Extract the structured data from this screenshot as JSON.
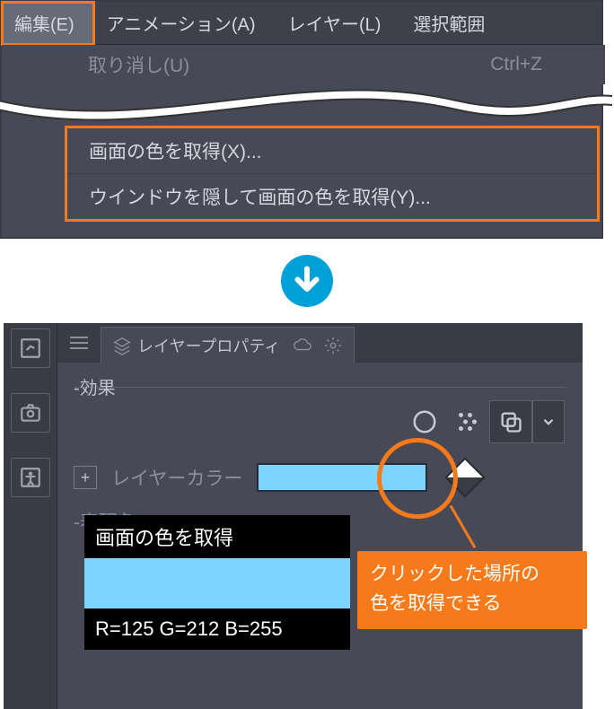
{
  "menubar": {
    "items": [
      {
        "label": "編集(E)",
        "active": true
      },
      {
        "label": "アニメーション(A)",
        "active": false
      },
      {
        "label": "レイヤー(L)",
        "active": false
      },
      {
        "label": "選択範囲",
        "active": false
      }
    ],
    "undo_label": "取り消し(U)",
    "undo_shortcut": "Ctrl+Z",
    "highlighted": [
      "画面の色を取得(X)...",
      "ウインドウを隠して画面の色を取得(Y)..."
    ]
  },
  "panel": {
    "tab_label": "レイヤープロパティ",
    "section_label": "効果",
    "layer_color_label": "レイヤーカラー",
    "expression_label": "表現色",
    "swatch_color": "#7dd4ff"
  },
  "popup": {
    "title": "画面の色を取得",
    "swatch_color": "#7dd4ff",
    "rgb_text": "R=125 G=212 B=255"
  },
  "callout": {
    "line1": "クリックした場所の",
    "line2": "色を取得できる"
  }
}
